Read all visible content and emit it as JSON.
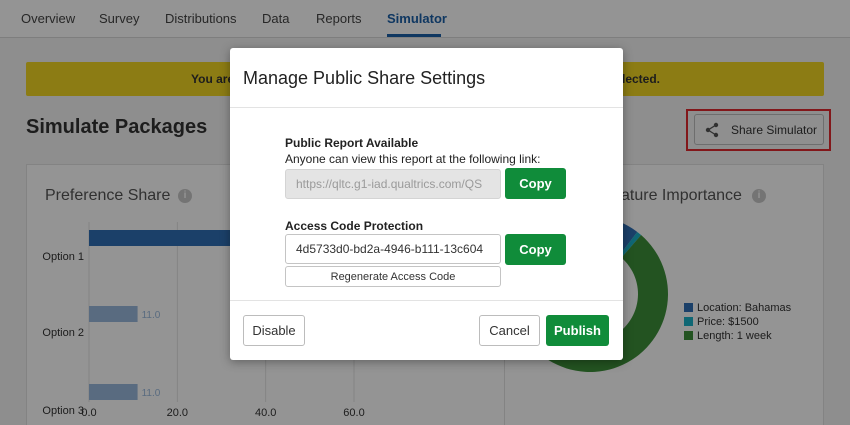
{
  "nav": {
    "tabs": [
      {
        "label": "Overview"
      },
      {
        "label": "Survey"
      },
      {
        "label": "Distributions"
      },
      {
        "label": "Data"
      },
      {
        "label": "Reports"
      },
      {
        "label": "Simulator",
        "active": true
      }
    ]
  },
  "banner": {
    "text_left": "You are",
    "text_right": "lected.",
    "color": "#f2d624"
  },
  "page": {
    "title": "Simulate Packages"
  },
  "share_button": {
    "label": "Share Simulator",
    "icon": "share-icon"
  },
  "preference_card": {
    "title": "Preference Share",
    "info_icon": "i"
  },
  "importance_card": {
    "title": "ature Importance",
    "info_icon": "i"
  },
  "chart_data": [
    {
      "type": "bar",
      "orientation": "horizontal",
      "title": "Preference Share",
      "categories": [
        "Option 1",
        "Option 2",
        "Option 3"
      ],
      "values": [
        78.0,
        11.0,
        11.0
      ],
      "data_labels": [
        "",
        "11.0",
        "11.0"
      ],
      "xticks": [
        "0.0",
        "20.0",
        "40.0",
        "60.0"
      ],
      "xlim": [
        0,
        60
      ],
      "colors": [
        "#2f6fb6",
        "#9ab9dd",
        "#9ab9dd"
      ],
      "grid": true
    },
    {
      "type": "pie",
      "style": "donut",
      "title": "ature Importance",
      "legend": [
        {
          "label": "Location: Bahamas",
          "color": "#2f6fb6"
        },
        {
          "label": "Price: $1500",
          "color": "#1bb1c9"
        },
        {
          "label": "Length: 1 week",
          "color": "#3d8f3a"
        }
      ],
      "values": [
        0.04,
        0.01,
        0.95
      ],
      "legend_position": "right"
    }
  ],
  "modal": {
    "title": "Manage Public Share Settings",
    "public_report": {
      "heading": "Public Report Available",
      "description": "Anyone can view this report at the following link:",
      "link_value": "https://qltc.g1-iad.qualtrics.com/QS",
      "copy_label": "Copy"
    },
    "access_code": {
      "heading": "Access Code Protection",
      "code_value": "4d5733d0-bd2a-4946-b111-13c604",
      "copy_label": "Copy",
      "regenerate_label": "Regenerate Access Code"
    },
    "footer": {
      "disable_label": "Disable",
      "cancel_label": "Cancel",
      "publish_label": "Publish"
    }
  },
  "colors": {
    "accent_blue": "#1a5fa8",
    "publish_green": "#108c3a",
    "highlight_red": "#e0282d"
  }
}
